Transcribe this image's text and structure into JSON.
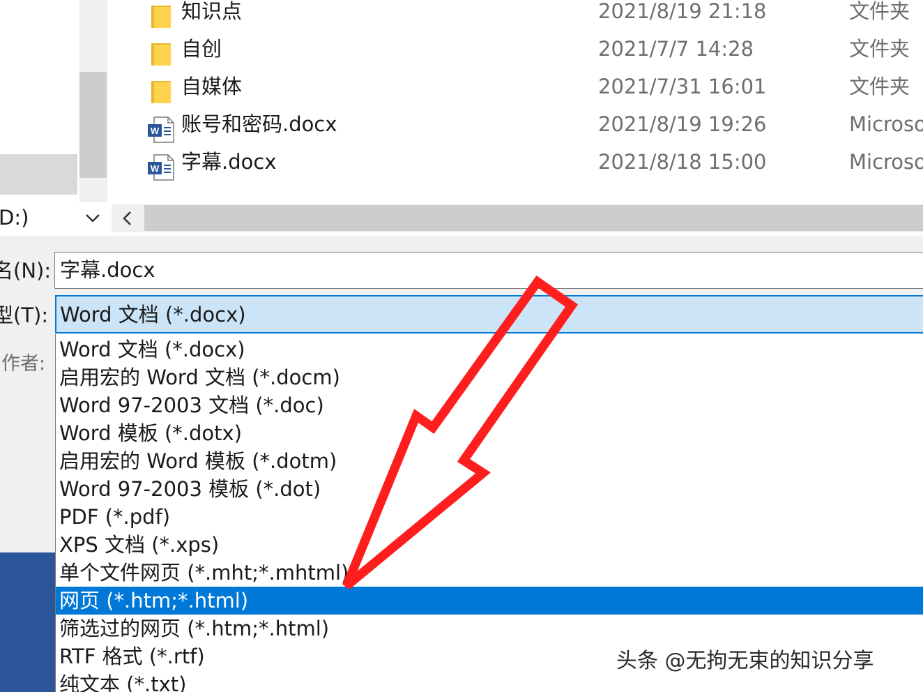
{
  "file_list": {
    "rows": [
      {
        "icon": "folder-icon",
        "name": "知识点",
        "date": "2021/8/19 21:18",
        "type": "文件夹"
      },
      {
        "icon": "folder-icon",
        "name": "自创",
        "date": "2021/7/7 14:28",
        "type": "文件夹"
      },
      {
        "icon": "folder-icon",
        "name": "自媒体",
        "date": "2021/7/31 16:01",
        "type": "文件夹"
      },
      {
        "icon": "word-doc-icon",
        "name": "账号和密码.docx",
        "date": "2021/8/19 19:26",
        "type": "Microso"
      },
      {
        "icon": "word-doc-icon",
        "name": "字幕.docx",
        "date": "2021/8/18 15:00",
        "type": "Microso"
      }
    ]
  },
  "nav": {
    "drive_label": "D:)"
  },
  "form": {
    "filename_label": "名(N):",
    "filename_value": "字幕.docx",
    "type_label": "型(T):",
    "type_value": "Word 文档 (*.docx)",
    "author_label": "作者:"
  },
  "dropdown": {
    "selected_index": 9,
    "options": [
      "Word 文档 (*.docx)",
      "启用宏的 Word 文档 (*.docm)",
      "Word 97-2003 文档 (*.doc)",
      "Word 模板 (*.dotx)",
      "启用宏的 Word 模板 (*.dotm)",
      "Word 97-2003 模板 (*.dot)",
      "PDF (*.pdf)",
      "XPS 文档 (*.xps)",
      "单个文件网页 (*.mht;*.mhtml)",
      "网页 (*.htm;*.html)",
      "筛选过的网页 (*.htm;*.html)",
      "RTF 格式 (*.rtf)",
      "纯文本 (*.txt)"
    ]
  },
  "watermark": "头条 @无拘无束的知识分享",
  "colors": {
    "selection": "#0078d7",
    "combo_fill": "#cce4f7",
    "arrow": "#ff1e1e",
    "folder": "#ffd34e",
    "word_blue": "#2b579a"
  }
}
